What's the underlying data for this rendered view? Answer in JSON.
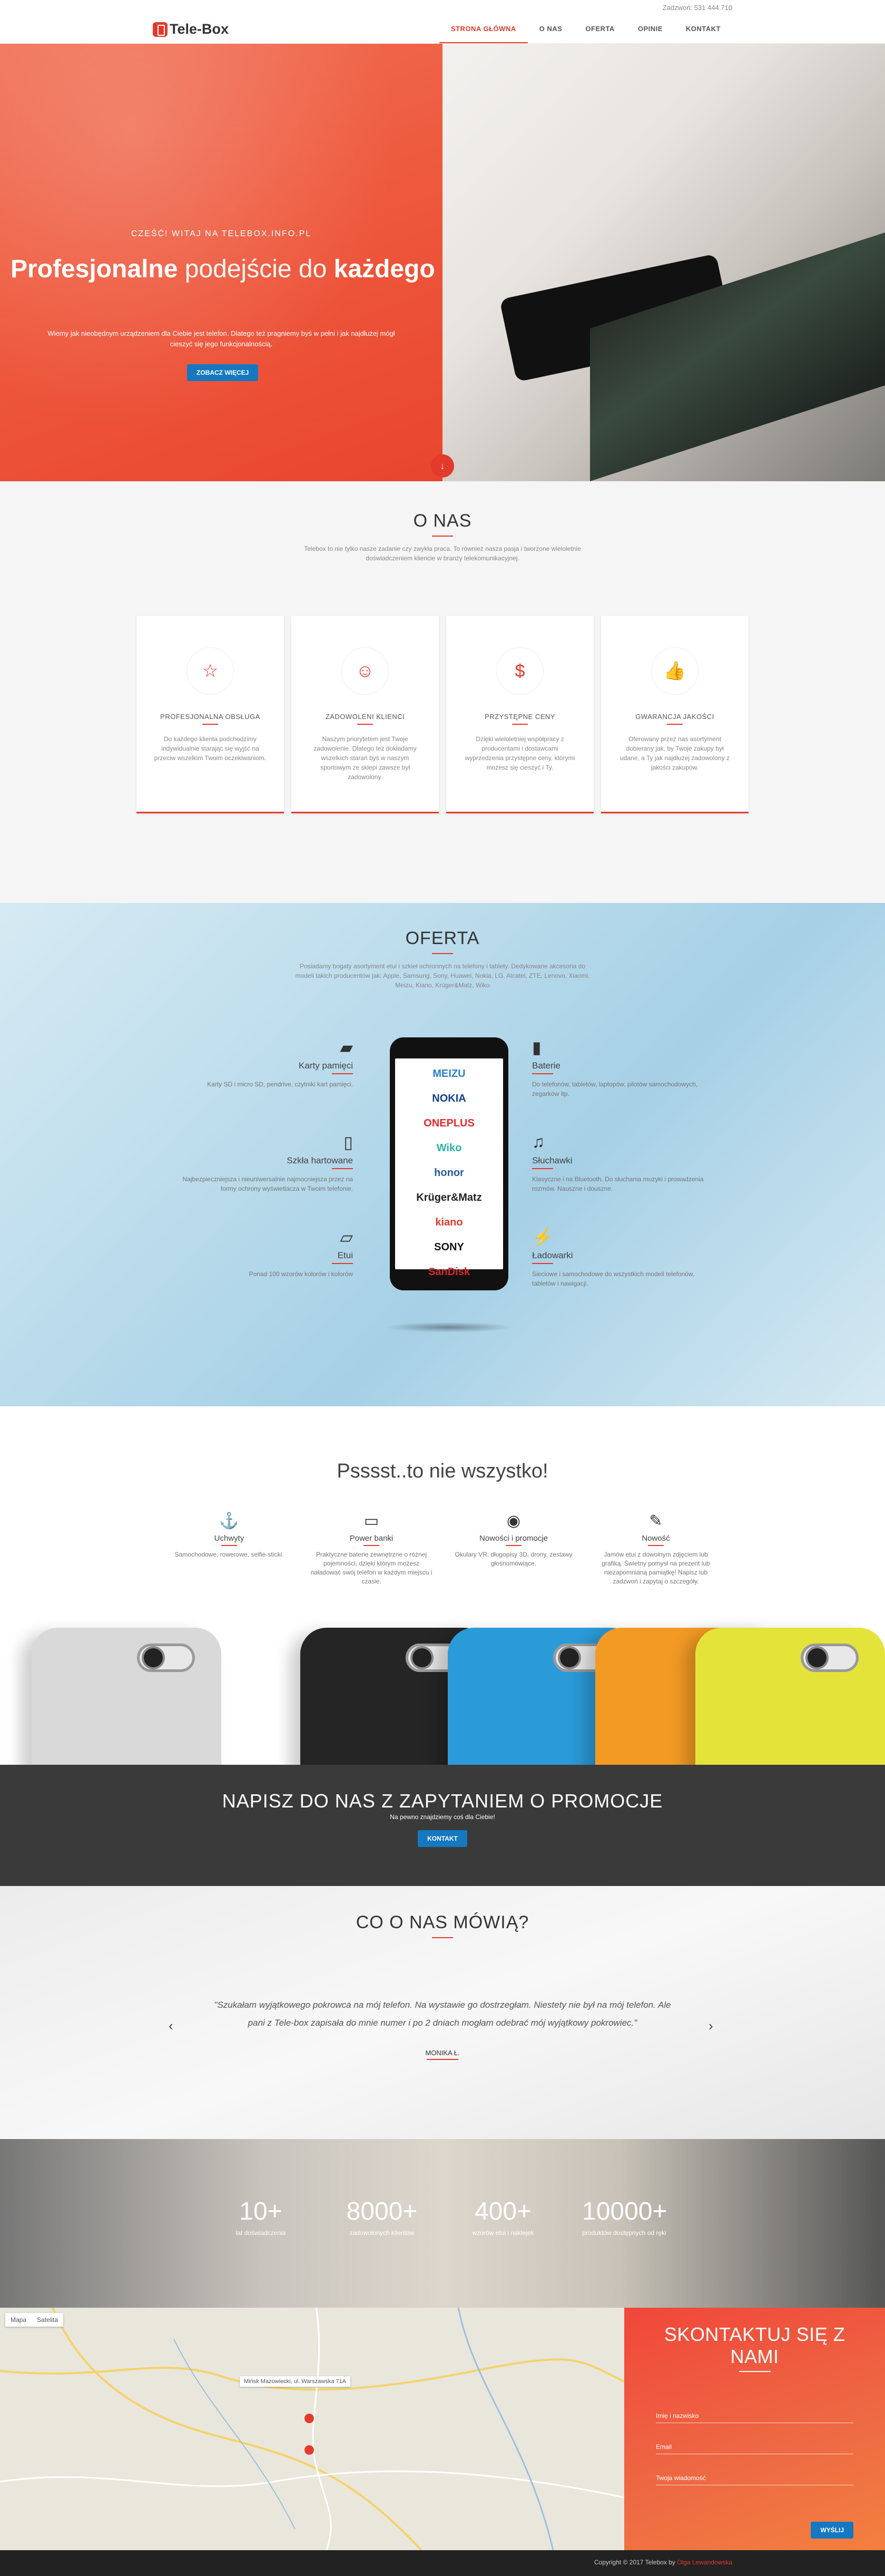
{
  "topbar": {
    "phone": "Zadzwoń: 531 444 710"
  },
  "nav": {
    "logo": "Tele-Box",
    "items": [
      "STRONA GŁÓWNA",
      "O NAS",
      "OFERTA",
      "OPINIE",
      "KONTAKT"
    ]
  },
  "hero": {
    "subtitle": "CZEŚĆ! WITAJ NA TELEBOX.INFO.PL",
    "title_bold": "Profesjonalne",
    "title_light": " podejście do ",
    "title_bold2": "każdego",
    "text": "Wiemy jak nieobędnym urządzeniem dla Ciebie jest telefon. Dlatego też pragniemy byś w pełni i jak najdłużej mógł cieszyć się jego funkcjonalnością.",
    "button": "ZOBACZ WIĘCEJ"
  },
  "about": {
    "title": "O NAS",
    "desc": "Telebox to nie tylko nasze zadanie czy zwykła praca. To również nasza pasja i tworzone wieloletnie doświadczeniem kliencie w branży telekomunikacyjnej.",
    "cards": [
      {
        "icon": "star-icon",
        "glyph": "☆",
        "title": "PROFESJONALNA OBSŁUGA",
        "text": "Do każdego klienta podchodzimy indywidualnie starając się wyjść na przeciw wszelkim Twoim oczekiwaniom."
      },
      {
        "icon": "smile-icon",
        "glyph": "☺",
        "title": "ZADOWOLENI KLIENCI",
        "text": "Naszym priorytetem jest Twoje zadowolenie. Dlatego też dokładamy wszelkich starań byś w naszym sportowym ze sklepi zawsze był zadowolony."
      },
      {
        "icon": "dollar-icon",
        "glyph": "$",
        "title": "PRZYSTĘPNE CENY",
        "text": "Dzięki wieloletniej współpracy z producentami i dostawcami wyprzedzenia przystępne ceny, którymi możesz się cieszyć i Ty."
      },
      {
        "icon": "thumbs-up-icon",
        "glyph": "👍",
        "title": "GWARANCJA JAKOŚCI",
        "text": "Oferowany przez nas asortyment dobierany jak, by Twoje zakupy był udane, a Ty jak najdłużej zadowolony z jakości zakupów."
      }
    ]
  },
  "offer": {
    "title": "OFERTA",
    "desc": "Posiadamy bogaty asortyment etui i szkieł ochronnych na telefony i tablety. Dedykowane akcesoria do modeli takich producentów jak: Apple, Samsung, Sony, Huawei, Nokia, LG, Alcatel, ZTE, Lenovo, Xiaomi, Meizu, Kiano, Krüger&Matz, Wiko",
    "left": [
      {
        "icon": "memory-card-icon",
        "glyph": "▰",
        "title": "Karty pamięci",
        "text": "Karty SD i micro SD, pendrive, czytniki kart pamięci."
      },
      {
        "icon": "phone-glass-icon",
        "glyph": "▯",
        "title": "Szkła hartowane",
        "text": "Najbezpieczniejsza i nieuniwersalnie najmocniejsza przez na formy ochrony wyświetlacza w Twoim telefonie."
      },
      {
        "icon": "case-icon",
        "glyph": "▱",
        "title": "Etui",
        "text": "Ponad 100 wzorów kolorów i kolorów"
      }
    ],
    "right": [
      {
        "icon": "battery-icon",
        "glyph": "▮",
        "title": "Baterie",
        "text": "Do telefonów, tabletów, laptopów, pilotów samochodowych, zegarków itp."
      },
      {
        "icon": "headphones-icon",
        "glyph": "♫",
        "title": "Słuchawki",
        "text": "Klasyczne i na Bluetooth. Do słuchania muzyki i prowadzenia rozmów. Nauszne i douszne."
      },
      {
        "icon": "charger-icon",
        "glyph": "⚡",
        "title": "Ładowarki",
        "text": "Sieciowe i samochodowe do wszystkich modeli telefonów, tabletów i nawigacji."
      }
    ],
    "brands": [
      {
        "name": "MEIZU",
        "color": "#2c7ccc"
      },
      {
        "name": "NOKIA",
        "color": "#124191"
      },
      {
        "name": "ONEPLUS",
        "color": "#e32b2b"
      },
      {
        "name": "Wiko",
        "color": "#2ab3a8"
      },
      {
        "name": "honor",
        "color": "#2a5aa0"
      },
      {
        "name": "Krüger&Matz",
        "color": "#222222"
      },
      {
        "name": "kiano",
        "color": "#e43a2c"
      },
      {
        "name": "SONY",
        "color": "#111111"
      },
      {
        "name": "SanDisk",
        "color": "#d6282e"
      }
    ]
  },
  "psst": {
    "title": "Psssst..to nie wszystko!",
    "items": [
      {
        "icon": "holder-icon",
        "glyph": "⚓",
        "title": "Uchwyty",
        "text": "Samochodowe, rowerowe, selfie-sticki."
      },
      {
        "icon": "powerbank-icon",
        "glyph": "▭",
        "title": "Power banki",
        "text": "Praktyczne baterie zewnętrzne o różnej pojemności, dzięki którym możesz naładować swój telefon w każdym miejscu i czasie."
      },
      {
        "icon": "novelty-icon",
        "glyph": "◉",
        "title": "Nowości i promocje",
        "text": "Okulary VR, długopisy 3D, drony, zestawy głośnomówiące."
      },
      {
        "icon": "paperclip-icon",
        "glyph": "✎",
        "title": "Nowość",
        "text": "Jamów etui z dowolnym zdjęciem lub grafiką. Świetny pomysł na prezent lub niezapomnianą pamiątkę! Napisz lub zadzwoń i zapytaj o szczegóły."
      }
    ],
    "case_colors": [
      "#d9d9d9",
      "#252525",
      "#2a9ad8",
      "#f39a24",
      "#e4e33a"
    ]
  },
  "promo": {
    "title": "NAPISZ DO NAS Z ZAPYTANIEM O PROMOCJE",
    "sub": "Na pewno znajdziemy coś dla Ciebie!",
    "button": "KONTAKT"
  },
  "testimonials": {
    "title": "CO O NAS MÓWIĄ?",
    "quote": "\"Szukałam wyjątkowego pokrowca na mój telefon. Na wystawie go dostrzegłam. Niestety nie był na mój telefon. Ale pani z Tele-box zapisała do mnie numer i po 2 dniach mogłam odebrać mój wyjątkowy pokrowiec.\"",
    "author": "MONIKA Ł."
  },
  "stats": [
    {
      "value": "10+",
      "label": "lat doświadczenia"
    },
    {
      "value": "8000+",
      "label": "zadowolonych klientów"
    },
    {
      "value": "400+",
      "label": "wzorów etui i naklejek"
    },
    {
      "value": "10000+",
      "label": "produktów dostępnych od ręki"
    }
  ],
  "contact": {
    "map_tabs": [
      "Mapa",
      "Satelita"
    ],
    "map_label": "Mińsk Mazowiecki, ul. Warszawska 71A",
    "title": "SKONTAKTUJ SIĘ Z NAMI",
    "fields": [
      "Imię i nazwisko",
      "Email",
      "Twoja wiadomość"
    ],
    "button": "WYŚLIJ"
  },
  "footer": {
    "copyright": "Copyright © 2017 Telebox by ",
    "author": "Olga Lewandowska"
  }
}
